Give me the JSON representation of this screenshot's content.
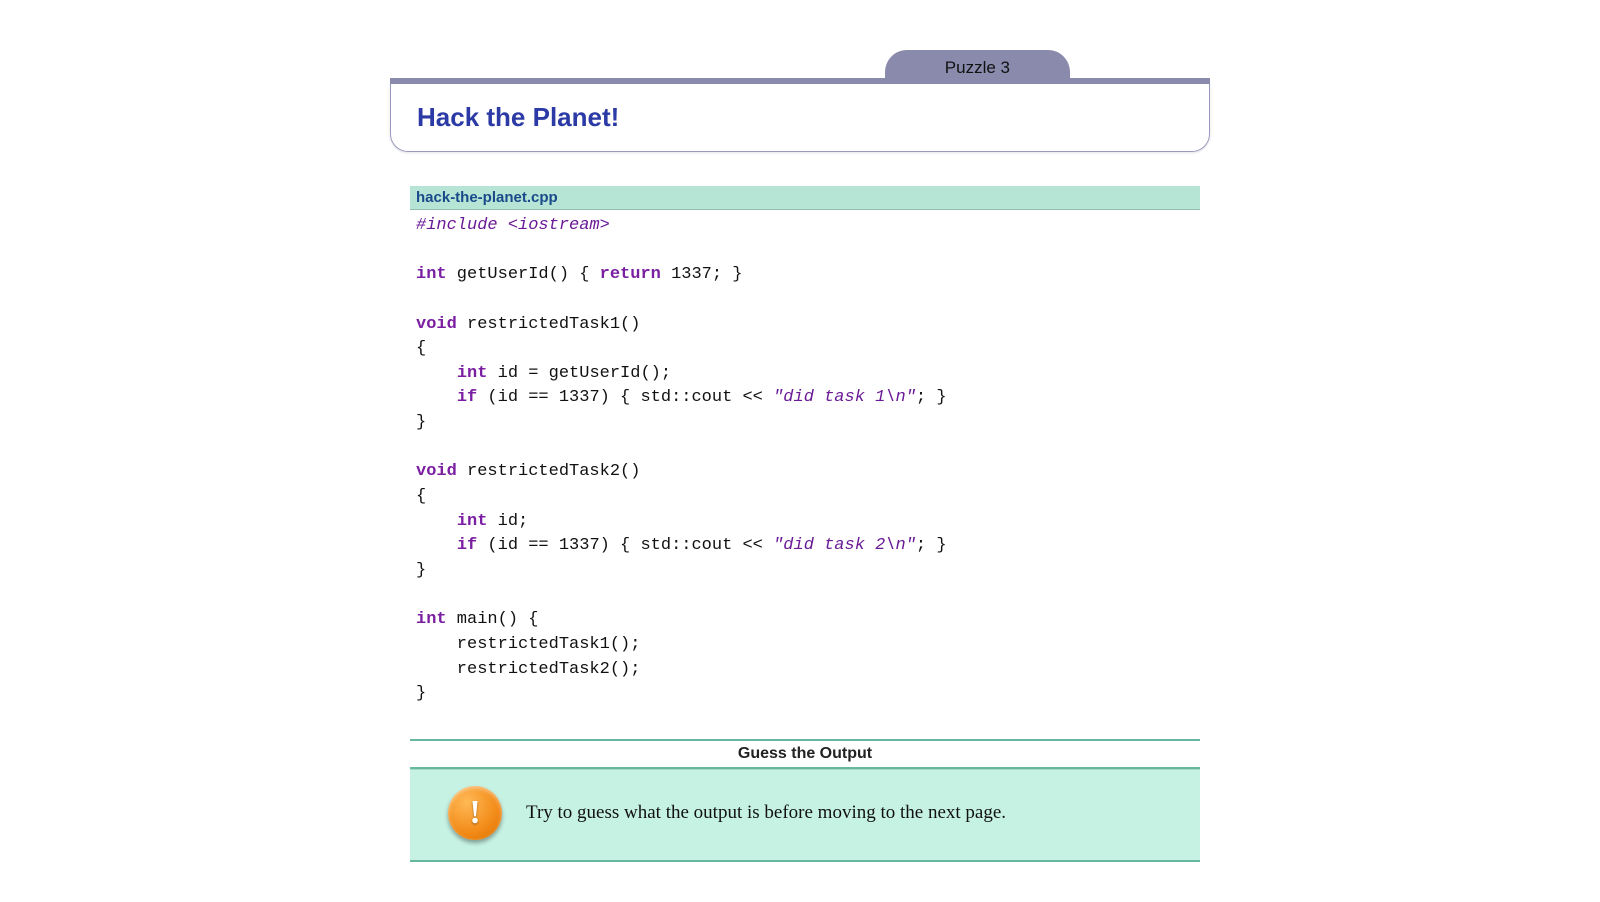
{
  "tab": {
    "label": "Puzzle 3"
  },
  "header": {
    "title": "Hack the Planet!"
  },
  "code": {
    "filename": "hack-the-planet.cpp",
    "tokens": {
      "include": "#include <iostream>",
      "kw_int": "int",
      "kw_void": "void",
      "kw_return": "return",
      "kw_if": "if",
      "fn_getUserId": " getUserId() { ",
      "num_1337": "1337",
      "semi_close": "; }",
      "fn_rt1": " restrictedTask1()",
      "open": "{",
      "close": "}",
      "line_id_assign": " id = getUserId();",
      "cond_open": " (id == ",
      "cond_close": ") { std::cout << ",
      "str1": "\"did task 1\\n\"",
      "str2": "\"did task 2\\n\"",
      "fn_rt2": " restrictedTask2()",
      "line_id_decl": " id;",
      "fn_main": " main() {",
      "call_rt1": "    restrictedTask1();",
      "call_rt2": "    restrictedTask2();"
    }
  },
  "guess": {
    "heading": "Guess the Output",
    "body": "Try to guess what the output is before moving to the next page."
  }
}
